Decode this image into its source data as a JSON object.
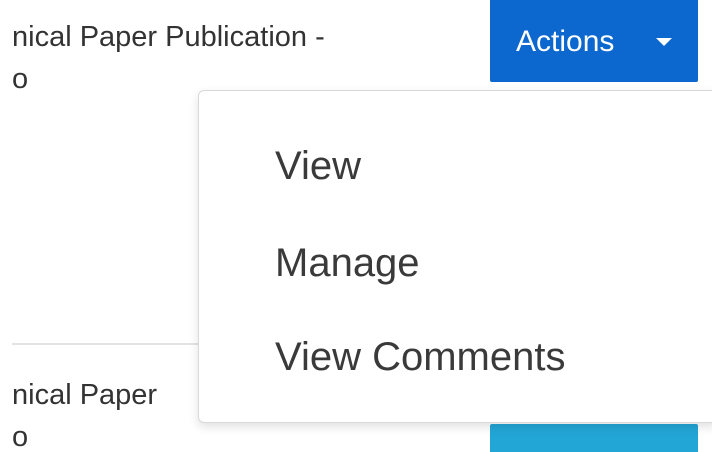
{
  "rows": [
    {
      "title": "nical Paper Publication -",
      "subtitle": "o"
    },
    {
      "title": "nical Paper",
      "subtitle": "o"
    }
  ],
  "actions_button": {
    "label": "Actions",
    "caret_icon": "caret-down-icon",
    "color": "#0c67cf"
  },
  "dropdown_menu": {
    "items": [
      {
        "label": "View"
      },
      {
        "label": "Manage"
      },
      {
        "label": "View Comments"
      }
    ]
  },
  "colors": {
    "primary_button": "#0c67cf",
    "secondary_button": "#22a6d6",
    "text": "#333333"
  }
}
